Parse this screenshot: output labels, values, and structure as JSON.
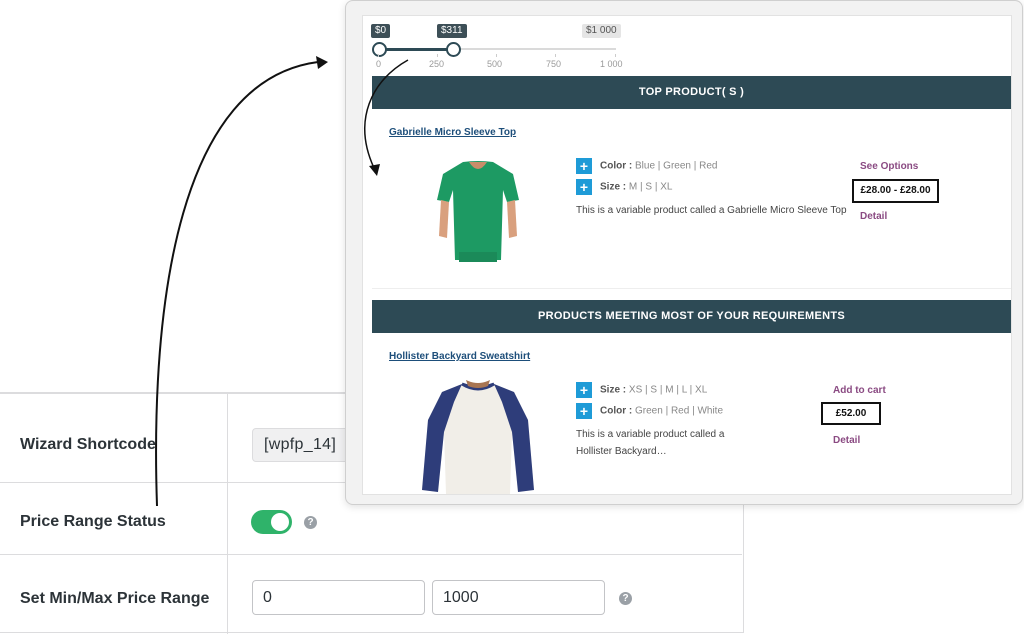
{
  "settings": {
    "rows": [
      {
        "label": "Wizard Shortcode",
        "value": "[wpfp_14]"
      },
      {
        "label": "Price Range Status",
        "enabled": true
      },
      {
        "label": "Set Min/Max Price Range",
        "min": "0",
        "max": "1000"
      }
    ],
    "help_glyph": "?"
  },
  "slider": {
    "min_label": "$0",
    "current_label": "$311",
    "max_label": "$1 000",
    "min_value": 0,
    "current_value": 311,
    "max_value": 1000,
    "ticks": [
      "0",
      "250",
      "500",
      "750",
      "1 000"
    ]
  },
  "sections": [
    {
      "heading": "TOP PRODUCT( S )",
      "product": {
        "title": "Gabrielle Micro Sleeve Top",
        "options": [
          {
            "label": "Color :",
            "values": "Blue | Green | Red"
          },
          {
            "label": "Size :",
            "values": "M | S | XL"
          }
        ],
        "description": "This is a variable product called a Gabrielle Micro Sleeve Top",
        "action": "See Options",
        "price": "£28.00 - £28.00",
        "detail": "Detail"
      }
    },
    {
      "heading": "PRODUCTS MEETING MOST OF YOUR REQUIREMENTS",
      "product": {
        "title": "Hollister Backyard Sweatshirt",
        "options": [
          {
            "label": "Size :",
            "values": "XS | S | M | L | XL"
          },
          {
            "label": "Color :",
            "values": "Green | Red | White"
          }
        ],
        "description_line1": "This is a variable product called a",
        "description_line2": "Hollister Backyard…",
        "action": "Add to cart",
        "price": "£52.00",
        "detail": "Detail"
      }
    }
  ],
  "colors": {
    "bar": "#2d4a55",
    "toggle_on": "#2fb36a",
    "plus_button": "#1e9bd7",
    "link_purple": "#8a4a82",
    "shirt_green": "#1d9a63",
    "sweatshirt_navy": "#2e3d7a"
  }
}
